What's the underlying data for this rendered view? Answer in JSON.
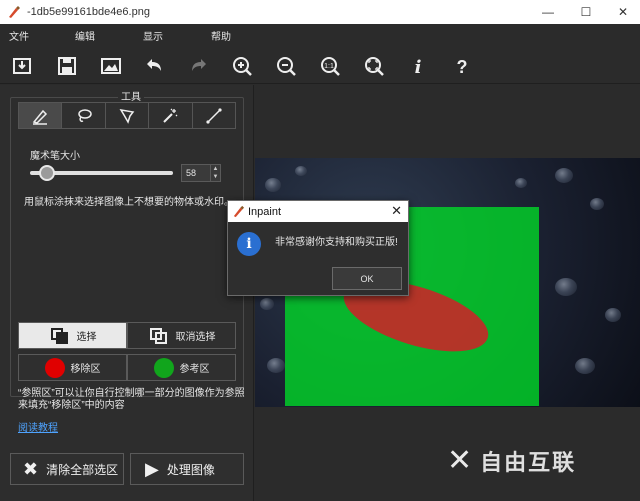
{
  "window": {
    "title": "-1db5e99161bde4e6.png",
    "minimize": "—",
    "maximize": "☐",
    "close": "✕"
  },
  "menu": [
    "文件",
    "编辑",
    "显示",
    "帮助"
  ],
  "toolbar": [
    "save-to-disk-icon",
    "save-icon",
    "open-image-icon",
    "undo-icon",
    "redo-icon",
    "zoom-in-icon",
    "zoom-out-icon",
    "zoom-actual-icon",
    "zoom-fit-icon",
    "info-icon",
    "help-icon"
  ],
  "tools_panel": {
    "title": "工具",
    "tools": [
      "marker-icon",
      "lasso-icon",
      "polygon-lasso-icon",
      "magic-wand-icon",
      "line-icon"
    ],
    "brush_label": "魔术笔大小",
    "brush_size": "58",
    "brush_level": 0.12,
    "hint": "用鼠标涂抹来选择图像上不想要的物体或水印。"
  },
  "selection": {
    "select": "选择",
    "deselect": "取消选择"
  },
  "markers": {
    "remove": "移除区",
    "reference": "参考区",
    "remove_color": "#e00000",
    "reference_color": "#11a51c"
  },
  "description": "“参照区”可以让你自行控制哪一部分的图像作为参照来填充“移除区”中的内容",
  "tutorial_link": "阅读教程",
  "actions": {
    "clear_all": "清除全部选区",
    "process": "处理图像"
  },
  "dialog": {
    "title": "Inpaint",
    "message": "非常感谢你支持和购买正版!",
    "ok": "OK",
    "close": "✕"
  },
  "watermark": "自由互联"
}
